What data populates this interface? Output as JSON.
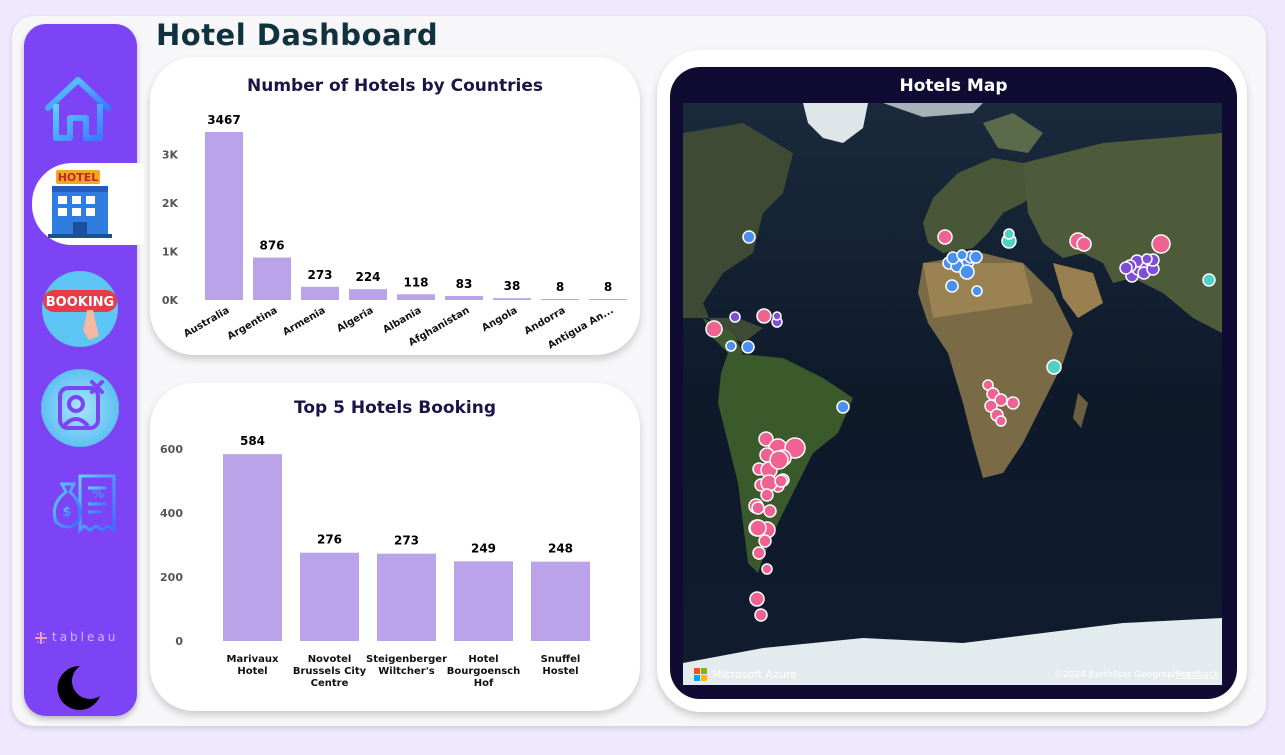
{
  "page": {
    "title": "Hotel Dashboard"
  },
  "sidebar": {
    "items": [
      {
        "name": "home",
        "icon": "home-icon"
      },
      {
        "name": "hotel",
        "icon": "hotel-icon",
        "label": "HOTEL",
        "active": true
      },
      {
        "name": "booking",
        "icon": "booking-icon",
        "label": "BOOKING"
      },
      {
        "name": "cancel-user",
        "icon": "user-cancel-icon"
      },
      {
        "name": "finance",
        "icon": "money-bag-receipt-icon"
      }
    ],
    "brand": "tableau",
    "theme_toggle_icon": "moon-icon"
  },
  "colors": {
    "sidebar": "#7c44f5",
    "bar": "#bba3ea",
    "title": "#0f3140",
    "card_title": "#1c1446",
    "map_bg": "#0f0b33"
  },
  "chart_data": [
    {
      "type": "bar",
      "title": "Number of Hotels by Countries",
      "categories": [
        "Australia",
        "Argentina",
        "Armenia",
        "Algeria",
        "Albania",
        "Afghanistan",
        "Angola",
        "Andorra",
        "Antigua An..."
      ],
      "values": [
        3467,
        876,
        273,
        224,
        118,
        83,
        38,
        8,
        8
      ],
      "data_labels": [
        "3467",
        "876",
        "273",
        "224",
        "118",
        "83",
        "38",
        "8",
        "8"
      ],
      "y_ticks": [
        "0K",
        "1K",
        "2K",
        "3K"
      ],
      "ylim": [
        0,
        3467
      ],
      "grid": false
    },
    {
      "type": "bar",
      "title": "Top 5 Hotels Booking",
      "categories": [
        "Marivaux Hotel",
        "Novotel Brussels City Centre",
        "Steigenberger Wiltcher's",
        "Hotel Bourgoensch Hof",
        "Snuffel Hostel"
      ],
      "category_lines": [
        [
          "Marivaux",
          "Hotel"
        ],
        [
          "Novotel",
          "Brussels City",
          "Centre"
        ],
        [
          "Steigenberger",
          "Wiltcher's"
        ],
        [
          "Hotel",
          "Bourgoensch",
          "Hof"
        ],
        [
          "Snuffel",
          "Hostel"
        ]
      ],
      "values": [
        584,
        276,
        273,
        249,
        248
      ],
      "data_labels": [
        "584",
        "276",
        "273",
        "249",
        "248"
      ],
      "y_ticks": [
        "0",
        "200",
        "400",
        "600"
      ],
      "ylim": [
        0,
        600
      ],
      "grid": false
    }
  ],
  "map": {
    "title": "Hotels Map",
    "provider": "Microsoft Azure",
    "copyright": "©2024 EarthStar Geographics",
    "feedback": "Feedback",
    "marker_colors": [
      "#f06292",
      "#4a90f0",
      "#7e4fd6",
      "#4fd1c5"
    ]
  }
}
